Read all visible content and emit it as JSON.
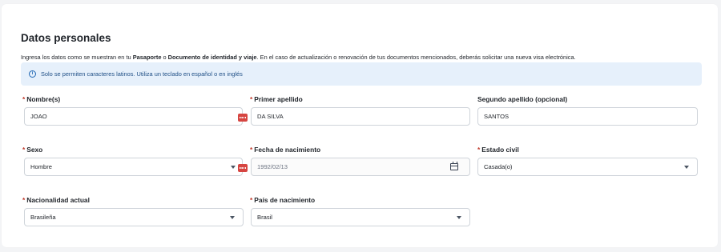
{
  "section": {
    "title": "Datos personales",
    "intro": {
      "part1": "Ingresa los datos como se muestran en tu ",
      "bold1": "Pasaporte",
      "part2": " o ",
      "bold2": "Documento de identidad y viaje",
      "part3": ". En el caso de actualización o renovación de tus documentos mencionados, deberás solicitar una nueva visa electrónica."
    },
    "info": {
      "icon": "info-icon",
      "text": "Solo se permiten caracteres latinos. Utiliza un teclado en español o en inglés"
    }
  },
  "required_marker": "*",
  "fields": {
    "nombres": {
      "label": "Nombre(s)",
      "value": "JOAO",
      "required": true
    },
    "primer_apellido": {
      "label": "Primer apellido",
      "value": "DA SILVA",
      "required": true
    },
    "segundo_apellido": {
      "label": "Segundo apellido (opcional)",
      "value": "SANTOS",
      "required": false
    },
    "sexo": {
      "label": "Sexo",
      "value": "Hombre",
      "required": true
    },
    "fecha_nacimiento": {
      "label": "Fecha de nacimiento",
      "value": "1992/02/13",
      "required": true
    },
    "estado_civil": {
      "label": "Estado civil",
      "value": "Casada(o)",
      "required": true
    },
    "nacionalidad": {
      "label": "Nacionalidad actual",
      "value": "Brasileña",
      "required": true
    },
    "pais_nacimiento": {
      "label": "País de nacimiento",
      "value": "Brasil",
      "required": true
    }
  },
  "colors": {
    "required": "#c0392b",
    "info_bg": "#e6f0fb",
    "badge": "#d64541"
  }
}
